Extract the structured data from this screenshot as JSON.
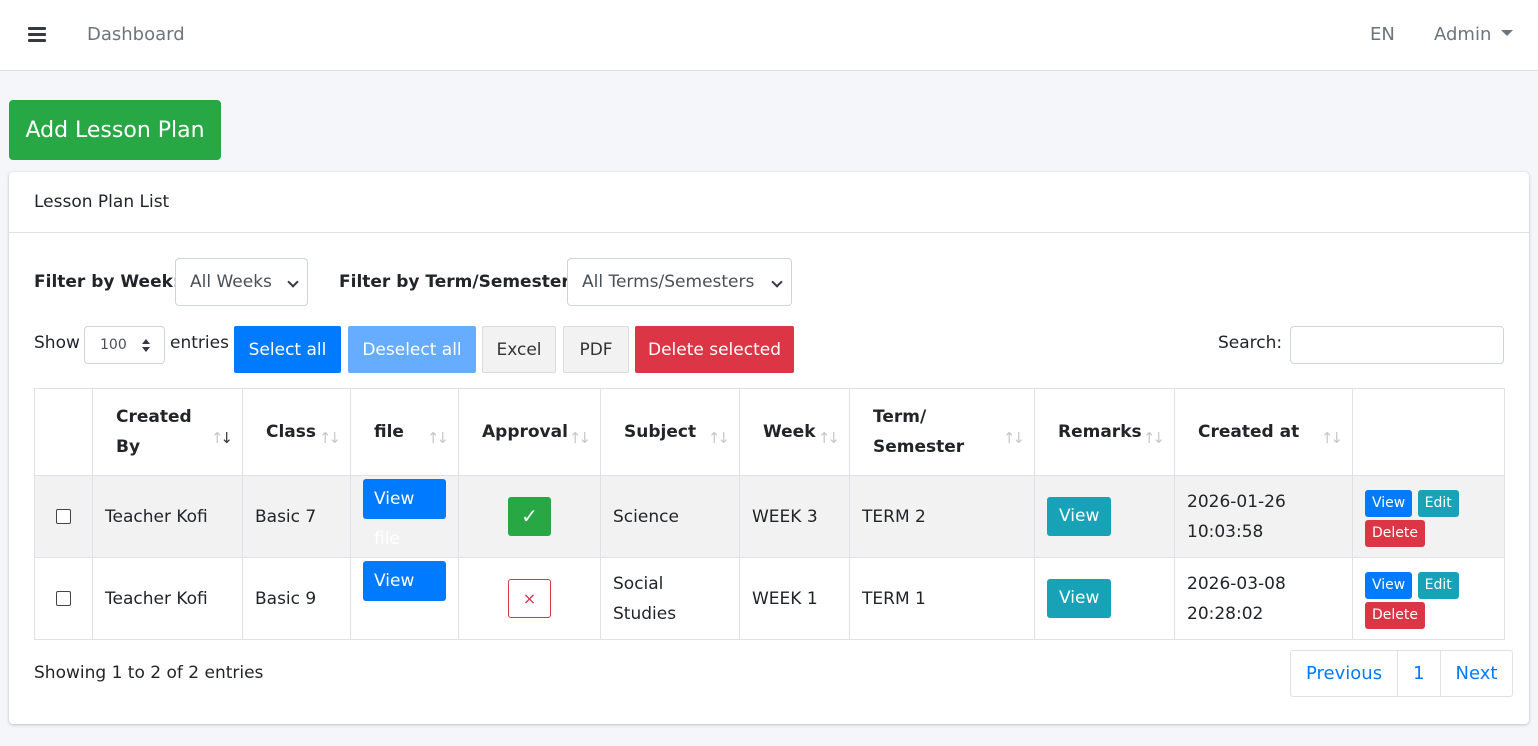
{
  "navbar": {
    "menu_icon": "bars-icon",
    "dashboard_link": "Dashboard",
    "language": "EN",
    "user": "Admin"
  },
  "add_button": "Add Lesson Plan",
  "card": {
    "title": "Lesson Plan List",
    "filter_week_label": "Filter by Week:",
    "filter_week_value": "All Weeks",
    "filter_term_label": "Filter by Term/Semester:",
    "filter_term_value": "All Terms/Semesters",
    "show_label": "Show",
    "entries_label": "entries",
    "page_length": "100",
    "buttons": {
      "select_all": "Select all",
      "deselect_all": "Deselect all",
      "excel": "Excel",
      "pdf": "PDF",
      "delete_selected": "Delete selected"
    },
    "search_label": "Search:",
    "search_value": ""
  },
  "table": {
    "headers": {
      "created_by_1": "Created",
      "created_by_2": "By",
      "class": "Class",
      "file": "file",
      "approval": "Approval",
      "subject": "Subject",
      "week": "Week",
      "term_1": "Term/",
      "term_2": "Semester",
      "remarks": "Remarks",
      "created_at": "Created at"
    },
    "rows": [
      {
        "created_by": "Teacher Kofi",
        "class": "Basic 7",
        "file_button": "View file",
        "approval": "✓",
        "subject": "Science",
        "week": "WEEK 3",
        "term": "TERM 2",
        "remarks_button": "View",
        "created_date": "2026-01-26",
        "created_time": "10:03:58",
        "view": "View",
        "edit": "Edit",
        "delete": "Delete"
      },
      {
        "created_by": "Teacher Kofi",
        "class": "Basic 9",
        "file_button": "View file",
        "approval": "×",
        "subject_1": "Social",
        "subject_2": "Studies",
        "week": "WEEK 1",
        "term": "TERM 1",
        "remarks_button": "View",
        "created_date": "2026-03-08",
        "created_time": "20:28:02",
        "view": "View",
        "edit": "Edit",
        "delete": "Delete"
      }
    ]
  },
  "footer": {
    "info": "Showing 1 to 2 of 2 entries",
    "previous": "Previous",
    "page": "1",
    "next": "Next"
  },
  "colors": {
    "primary": "#007bff",
    "success": "#28a745",
    "info": "#17a2b8",
    "danger": "#dc3545"
  }
}
